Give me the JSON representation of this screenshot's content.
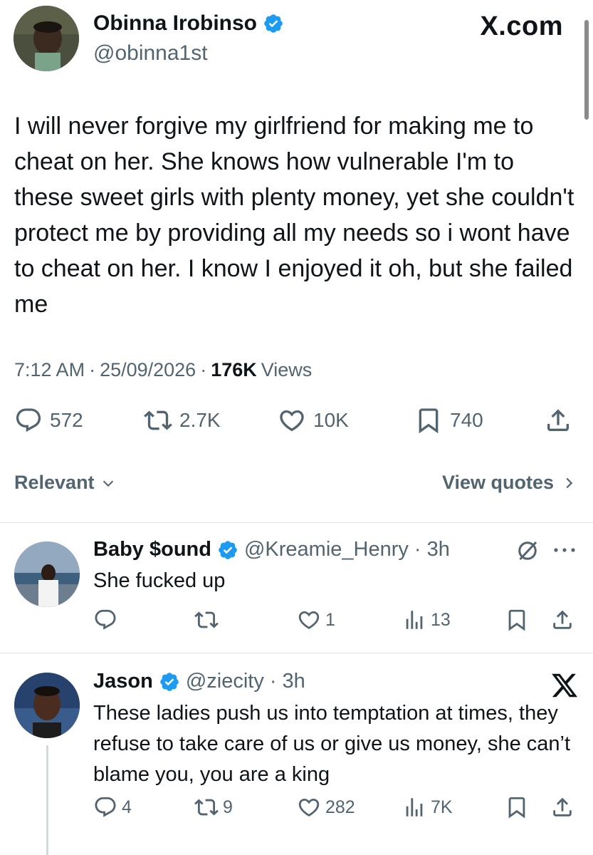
{
  "tweet": {
    "author_name": "Obinna Irobinso",
    "author_handle": "@obinna1st",
    "site_logo": "X.com",
    "body": "I will never forgive my girlfriend for making me to cheat on her. She knows how vulnerable I'm to these sweet girls with plenty money, yet she couldn't protect me by providing all my needs so i wont have to cheat on her. I know I enjoyed it oh, but she failed me",
    "time": "7:12 AM",
    "date": "25/09/2026",
    "views_count": "176K",
    "views_label": "Views",
    "replies": "572",
    "retweets": "2.7K",
    "likes": "10K",
    "bookmarks": "740"
  },
  "sort": {
    "label": "Relevant",
    "view_quotes": "View quotes"
  },
  "replies": [
    {
      "name": "Baby $ound",
      "handle": "@Kreamie_Henry",
      "age": "3h",
      "text": "She fucked up",
      "replies": "",
      "retweets": "",
      "likes": "1",
      "views": "13"
    },
    {
      "name": "Jason",
      "handle": "@ziecity",
      "age": "3h",
      "text": "These ladies push us into temptation at times, they refuse to take care of us or give us money, she can’t blame you, you are a king",
      "replies": "4",
      "retweets": "9",
      "likes": "282",
      "views": "7K"
    }
  ],
  "colors": {
    "verified": "#1d9bf0",
    "text": "#0f1419",
    "secondary": "#536471",
    "divider": "#dfe3e6"
  },
  "icons": [
    "verified-badge-icon",
    "reply-icon",
    "retweet-icon",
    "like-icon",
    "bookmark-icon",
    "share-icon",
    "views-icon",
    "chevron-down-icon",
    "chevron-right-icon",
    "grok-icon",
    "more-icon",
    "x-logo-icon"
  ]
}
